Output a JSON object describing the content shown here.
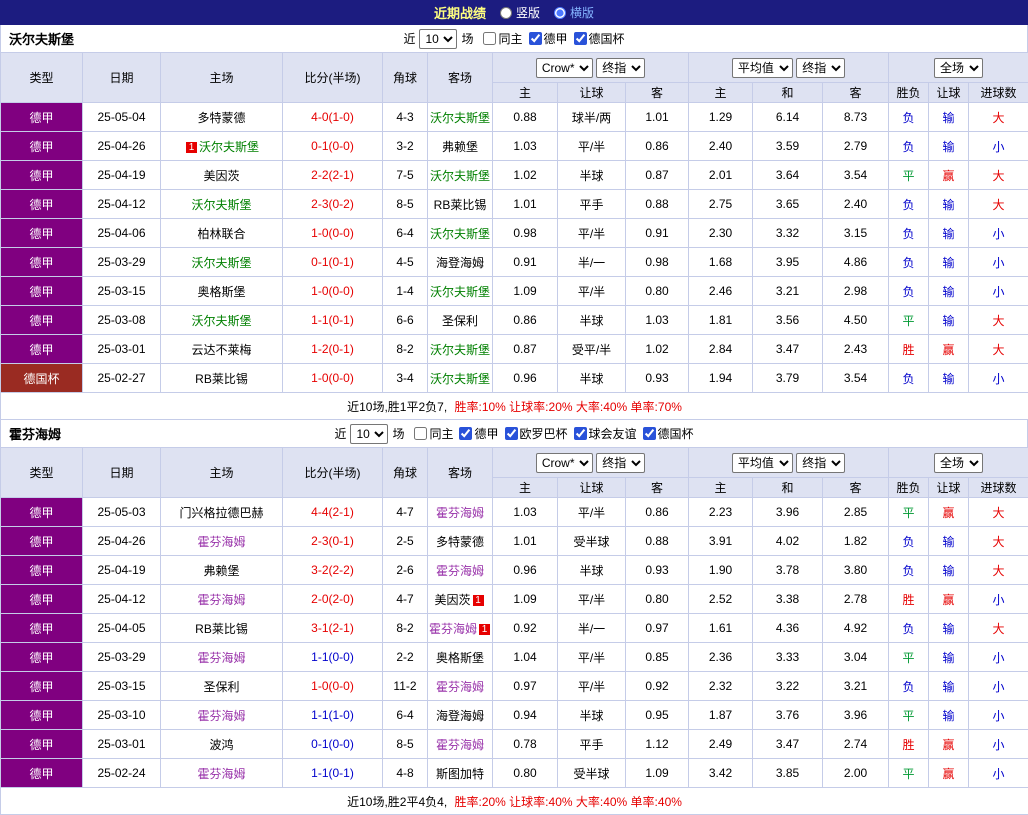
{
  "colors": {
    "titlebar_bg": "#1c1c80",
    "title_text": "#ffff80",
    "active_tab_text": "#85b4ff",
    "header_bg": "#dee2f2",
    "grid_line": "#c5cce8",
    "red": "#e60000",
    "blue": "#0000cc",
    "draw_green": "#009933"
  },
  "titlebar": {
    "title": "近期战绩",
    "vertical_label": "竖版",
    "horizontal_label": "横版"
  },
  "filter_labels": {
    "recent": "近",
    "count": "10",
    "games": "场"
  },
  "table_header": {
    "type": "类型",
    "date": "日期",
    "home": "主场",
    "score": "比分(半场)",
    "corner": "角球",
    "away": "客场",
    "asia_home": "主",
    "asia_handicap": "让球",
    "asia_away": "客",
    "euro_home": "主",
    "euro_draw": "和",
    "euro_away": "客",
    "result": "胜负",
    "handicap_result": "让球",
    "goals": "进球数"
  },
  "dropdowns": {
    "odds_source": "Crow*",
    "odds_stage": "终指",
    "euro_source": "平均值",
    "euro_stage": "终指",
    "scope": "全场"
  },
  "value_colors": {
    "胜": "#e60000",
    "平": "#009933",
    "负": "#0000cc",
    "赢": "#e60000",
    "输": "#0000cc",
    "大": "#e60000",
    "小": "#0000cc"
  },
  "league_colors": {
    "德甲": "#800080",
    "德国杯": "#9a2b22"
  },
  "score_colors": {
    "red": "#e60000",
    "blue": "#0000cc"
  },
  "tables": [
    {
      "team": "沃尔夫斯堡",
      "focus_color": "#008000",
      "filters": [
        {
          "label": "同主",
          "checked": false
        },
        {
          "label": "德甲",
          "checked": true
        },
        {
          "label": "德国杯",
          "checked": true
        }
      ],
      "rows": [
        {
          "league": "德甲",
          "date": "25-05-04",
          "home": "多特蒙德",
          "away": "沃尔夫斯堡",
          "away_focus": true,
          "score": "4-0(1-0)",
          "score_color": "red",
          "corner": "4-3",
          "ah": [
            "0.88",
            "球半/两",
            "1.01"
          ],
          "eu": [
            "1.29",
            "6.14",
            "8.73"
          ],
          "res": [
            "负",
            "输",
            "大"
          ]
        },
        {
          "league": "德甲",
          "date": "25-04-26",
          "home": "沃尔夫斯堡",
          "home_focus": true,
          "home_badge": "1",
          "away": "弗赖堡",
          "score": "0-1(0-0)",
          "score_color": "red",
          "corner": "3-2",
          "ah": [
            "1.03",
            "平/半",
            "0.86"
          ],
          "eu": [
            "2.40",
            "3.59",
            "2.79"
          ],
          "res": [
            "负",
            "输",
            "小"
          ]
        },
        {
          "league": "德甲",
          "date": "25-04-19",
          "home": "美因茨",
          "away": "沃尔夫斯堡",
          "away_focus": true,
          "score": "2-2(2-1)",
          "score_color": "red",
          "corner": "7-5",
          "ah": [
            "1.02",
            "半球",
            "0.87"
          ],
          "eu": [
            "2.01",
            "3.64",
            "3.54"
          ],
          "res": [
            "平",
            "赢",
            "大"
          ]
        },
        {
          "league": "德甲",
          "date": "25-04-12",
          "home": "沃尔夫斯堡",
          "home_focus": true,
          "away": "RB莱比锡",
          "score": "2-3(0-2)",
          "score_color": "red",
          "corner": "8-5",
          "ah": [
            "1.01",
            "平手",
            "0.88"
          ],
          "eu": [
            "2.75",
            "3.65",
            "2.40"
          ],
          "res": [
            "负",
            "输",
            "大"
          ]
        },
        {
          "league": "德甲",
          "date": "25-04-06",
          "home": "柏林联合",
          "away": "沃尔夫斯堡",
          "away_focus": true,
          "score": "1-0(0-0)",
          "score_color": "red",
          "corner": "6-4",
          "ah": [
            "0.98",
            "平/半",
            "0.91"
          ],
          "eu": [
            "2.30",
            "3.32",
            "3.15"
          ],
          "res": [
            "负",
            "输",
            "小"
          ]
        },
        {
          "league": "德甲",
          "date": "25-03-29",
          "home": "沃尔夫斯堡",
          "home_focus": true,
          "away": "海登海姆",
          "score": "0-1(0-1)",
          "score_color": "red",
          "corner": "4-5",
          "ah": [
            "0.91",
            "半/一",
            "0.98"
          ],
          "eu": [
            "1.68",
            "3.95",
            "4.86"
          ],
          "res": [
            "负",
            "输",
            "小"
          ]
        },
        {
          "league": "德甲",
          "date": "25-03-15",
          "home": "奥格斯堡",
          "away": "沃尔夫斯堡",
          "away_focus": true,
          "score": "1-0(0-0)",
          "score_color": "red",
          "corner": "1-4",
          "ah": [
            "1.09",
            "平/半",
            "0.80"
          ],
          "eu": [
            "2.46",
            "3.21",
            "2.98"
          ],
          "res": [
            "负",
            "输",
            "小"
          ]
        },
        {
          "league": "德甲",
          "date": "25-03-08",
          "home": "沃尔夫斯堡",
          "home_focus": true,
          "away": "圣保利",
          "score": "1-1(0-1)",
          "score_color": "red",
          "corner": "6-6",
          "ah": [
            "0.86",
            "半球",
            "1.03"
          ],
          "eu": [
            "1.81",
            "3.56",
            "4.50"
          ],
          "res": [
            "平",
            "输",
            "大"
          ]
        },
        {
          "league": "德甲",
          "date": "25-03-01",
          "home": "云达不莱梅",
          "away": "沃尔夫斯堡",
          "away_focus": true,
          "score": "1-2(0-1)",
          "score_color": "red",
          "corner": "8-2",
          "ah": [
            "0.87",
            "受平/半",
            "1.02"
          ],
          "eu": [
            "2.84",
            "3.47",
            "2.43"
          ],
          "res": [
            "胜",
            "赢",
            "大"
          ]
        },
        {
          "league": "德国杯",
          "date": "25-02-27",
          "home": "RB莱比锡",
          "away": "沃尔夫斯堡",
          "away_focus": true,
          "score": "1-0(0-0)",
          "score_color": "red",
          "corner": "3-4",
          "ah": [
            "0.96",
            "半球",
            "0.93"
          ],
          "eu": [
            "1.94",
            "3.79",
            "3.54"
          ],
          "res": [
            "负",
            "输",
            "小"
          ]
        }
      ],
      "summary": {
        "prefix": "近10场,胜1平2负7, ",
        "stats": "胜率:10% 让球率:20% 大率:40% 单率:70%"
      }
    },
    {
      "team": "霍芬海姆",
      "focus_color": "#9933aa",
      "filters": [
        {
          "label": "同主",
          "checked": false
        },
        {
          "label": "德甲",
          "checked": true
        },
        {
          "label": "欧罗巴杯",
          "checked": true
        },
        {
          "label": "球会友谊",
          "checked": true
        },
        {
          "label": "德国杯",
          "checked": true
        }
      ],
      "rows": [
        {
          "league": "德甲",
          "date": "25-05-03",
          "home": "门兴格拉德巴赫",
          "away": "霍芬海姆",
          "away_focus": true,
          "score": "4-4(2-1)",
          "score_color": "red",
          "corner": "4-7",
          "ah": [
            "1.03",
            "平/半",
            "0.86"
          ],
          "eu": [
            "2.23",
            "3.96",
            "2.85"
          ],
          "res": [
            "平",
            "赢",
            "大"
          ]
        },
        {
          "league": "德甲",
          "date": "25-04-26",
          "home": "霍芬海姆",
          "home_focus": true,
          "away": "多特蒙德",
          "score": "2-3(0-1)",
          "score_color": "red",
          "corner": "2-5",
          "ah": [
            "1.01",
            "受半球",
            "0.88"
          ],
          "eu": [
            "3.91",
            "4.02",
            "1.82"
          ],
          "res": [
            "负",
            "输",
            "大"
          ]
        },
        {
          "league": "德甲",
          "date": "25-04-19",
          "home": "弗赖堡",
          "away": "霍芬海姆",
          "away_focus": true,
          "score": "3-2(2-2)",
          "score_color": "red",
          "corner": "2-6",
          "ah": [
            "0.96",
            "半球",
            "0.93"
          ],
          "eu": [
            "1.90",
            "3.78",
            "3.80"
          ],
          "res": [
            "负",
            "输",
            "大"
          ]
        },
        {
          "league": "德甲",
          "date": "25-04-12",
          "home": "霍芬海姆",
          "home_focus": true,
          "away": "美因茨",
          "away_badge": "1",
          "score": "2-0(2-0)",
          "score_color": "red",
          "corner": "4-7",
          "ah": [
            "1.09",
            "平/半",
            "0.80"
          ],
          "eu": [
            "2.52",
            "3.38",
            "2.78"
          ],
          "res": [
            "胜",
            "赢",
            "小"
          ]
        },
        {
          "league": "德甲",
          "date": "25-04-05",
          "home": "RB莱比锡",
          "away": "霍芬海姆",
          "away_focus": true,
          "away_badge": "1",
          "score": "3-1(2-1)",
          "score_color": "red",
          "corner": "8-2",
          "ah": [
            "0.92",
            "半/一",
            "0.97"
          ],
          "eu": [
            "1.61",
            "4.36",
            "4.92"
          ],
          "res": [
            "负",
            "输",
            "大"
          ]
        },
        {
          "league": "德甲",
          "date": "25-03-29",
          "home": "霍芬海姆",
          "home_focus": true,
          "away": "奥格斯堡",
          "score": "1-1(0-0)",
          "score_color": "blue",
          "corner": "2-2",
          "ah": [
            "1.04",
            "平/半",
            "0.85"
          ],
          "eu": [
            "2.36",
            "3.33",
            "3.04"
          ],
          "res": [
            "平",
            "输",
            "小"
          ]
        },
        {
          "league": "德甲",
          "date": "25-03-15",
          "home": "圣保利",
          "away": "霍芬海姆",
          "away_focus": true,
          "score": "1-0(0-0)",
          "score_color": "red",
          "corner": "11-2",
          "ah": [
            "0.97",
            "平/半",
            "0.92"
          ],
          "eu": [
            "2.32",
            "3.22",
            "3.21"
          ],
          "res": [
            "负",
            "输",
            "小"
          ]
        },
        {
          "league": "德甲",
          "date": "25-03-10",
          "home": "霍芬海姆",
          "home_focus": true,
          "away": "海登海姆",
          "score": "1-1(1-0)",
          "score_color": "blue",
          "corner": "6-4",
          "ah": [
            "0.94",
            "半球",
            "0.95"
          ],
          "eu": [
            "1.87",
            "3.76",
            "3.96"
          ],
          "res": [
            "平",
            "输",
            "小"
          ]
        },
        {
          "league": "德甲",
          "date": "25-03-01",
          "home": "波鸿",
          "away": "霍芬海姆",
          "away_focus": true,
          "score": "0-1(0-0)",
          "score_color": "blue",
          "corner": "8-5",
          "ah": [
            "0.78",
            "平手",
            "1.12"
          ],
          "eu": [
            "2.49",
            "3.47",
            "2.74"
          ],
          "res": [
            "胜",
            "赢",
            "小"
          ]
        },
        {
          "league": "德甲",
          "date": "25-02-24",
          "home": "霍芬海姆",
          "home_focus": true,
          "away": "斯图加特",
          "score": "1-1(0-1)",
          "score_color": "blue",
          "corner": "4-8",
          "ah": [
            "0.80",
            "受半球",
            "1.09"
          ],
          "eu": [
            "3.42",
            "3.85",
            "2.00"
          ],
          "res": [
            "平",
            "赢",
            "小"
          ]
        }
      ],
      "summary": {
        "prefix": "近10场,胜2平4负4, ",
        "stats": "胜率:20% 让球率:40% 大率:40% 单率:40%"
      }
    }
  ]
}
